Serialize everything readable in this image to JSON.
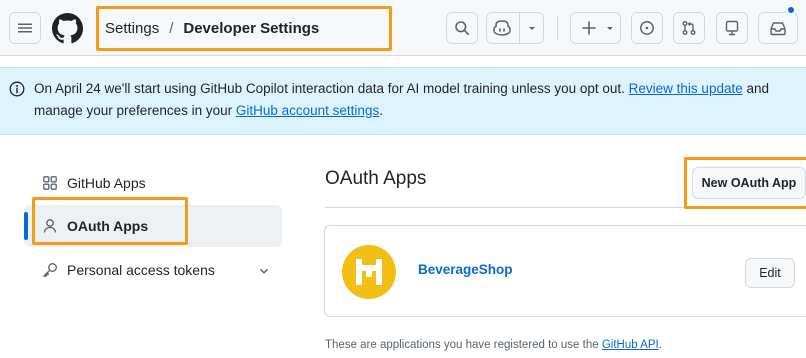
{
  "header": {
    "breadcrumb": {
      "parent": "Settings",
      "separator": "/",
      "current": "Developer Settings"
    },
    "icons": [
      "hamburger-icon",
      "github-logo",
      "search-icon",
      "copilot-icon",
      "plus-icon",
      "issues-icon",
      "pull-requests-icon",
      "codespaces-icon",
      "inbox-icon"
    ],
    "accent": "#0969da"
  },
  "banner": {
    "text_before": "On April 24 we'll start using GitHub Copilot interaction data for AI model training unless you opt out. ",
    "link_review": "Review this update",
    "text_middle": " and manage your preferences in your ",
    "link_settings": "GitHub account settings",
    "text_after": "."
  },
  "sidebar": {
    "items": [
      {
        "label": "GitHub Apps",
        "icon": "apps-grid-icon",
        "active": false
      },
      {
        "label": "OAuth Apps",
        "icon": "person-icon",
        "active": true
      },
      {
        "label": "Personal access tokens",
        "icon": "key-icon",
        "active": false
      }
    ]
  },
  "main": {
    "title": "OAuth Apps",
    "new_button": "New OAuth App",
    "apps": [
      {
        "name": "BeverageShop",
        "edit_label": "Edit",
        "avatar_color": "#f2bf17"
      }
    ],
    "footer": {
      "text_before": "These are applications you have registered to use the ",
      "link": "GitHub API",
      "text_after": "."
    }
  },
  "highlight_color": "#f59b17"
}
